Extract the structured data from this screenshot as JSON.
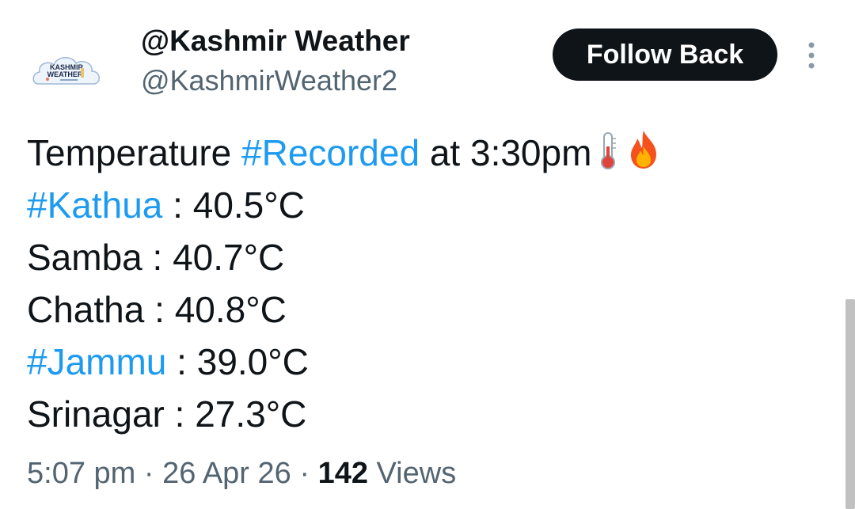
{
  "author": {
    "display_name": "@Kashmir Weather",
    "handle": "@KashmirWeather2",
    "avatar_text_line1": "KASHMIR",
    "avatar_text_line2": "WEATHER"
  },
  "actions": {
    "follow_label": "Follow Back",
    "more_icon": "vertical-ellipsis-icon"
  },
  "tweet": {
    "line1": {
      "prefix": "Temperature ",
      "hashtag": "#Recorded",
      "suffix": " at 3:30pm",
      "emojis": [
        "thermometer-icon",
        "fire-icon"
      ]
    },
    "readings": [
      {
        "place": "#Kathua",
        "is_hashtag": true,
        "sep": " : ",
        "value": "40.5°C"
      },
      {
        "place": "Samba",
        "is_hashtag": false,
        "sep": " : ",
        "value": "40.7°C"
      },
      {
        "place": "Chatha",
        "is_hashtag": false,
        "sep": " : ",
        "value": "40.8°C"
      },
      {
        "place": "#Jammu",
        "is_hashtag": true,
        "sep": " : ",
        "value": "39.0°C"
      },
      {
        "place": "Srinagar",
        "is_hashtag": false,
        "sep": " : ",
        "value": "27.3°C"
      }
    ]
  },
  "meta": {
    "time": "5:07 pm",
    "separator": " · ",
    "date": "26 Apr 26",
    "views_count": "142",
    "views_label": " Views"
  },
  "colors": {
    "hashtag": "#1d9bf0",
    "text": "#0f1419",
    "secondary": "#536471",
    "button_bg": "#0f1419"
  }
}
